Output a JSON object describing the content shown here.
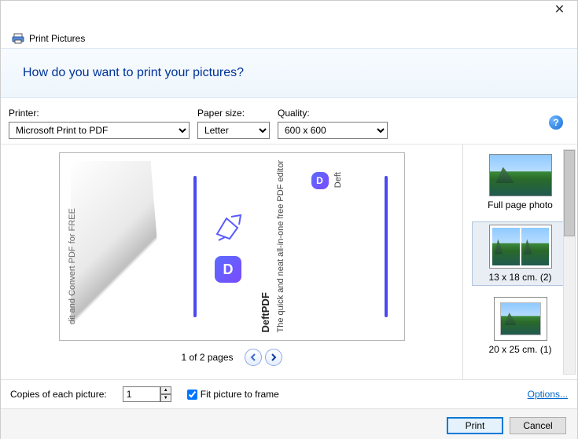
{
  "window": {
    "title": "Print Pictures"
  },
  "heading": "How do you want to print your pictures?",
  "labels": {
    "printer": "Printer:",
    "paper_size": "Paper size:",
    "quality": "Quality:",
    "copies": "Copies of each picture:",
    "fit": "Fit picture to frame",
    "options": "Options..."
  },
  "selects": {
    "printer": "Microsoft Print to PDF",
    "paper_size": "Letter",
    "quality": "600 x 600"
  },
  "copies_value": "1",
  "fit_checked": true,
  "pager": {
    "text": "1 of 2 pages"
  },
  "preview": {
    "curl_text": "dit and Convert PDF for FREE",
    "brand_small": "Deft",
    "brand": "DeftPDF",
    "tagline": "The quick and neat all-in-one free PDF editor"
  },
  "layouts": [
    {
      "id": "full",
      "label": "Full page photo",
      "selected": false
    },
    {
      "id": "13x18",
      "label": "13 x 18 cm. (2)",
      "selected": true
    },
    {
      "id": "20x25",
      "label": "20 x 25 cm. (1)",
      "selected": false
    }
  ],
  "buttons": {
    "print": "Print",
    "cancel": "Cancel"
  }
}
